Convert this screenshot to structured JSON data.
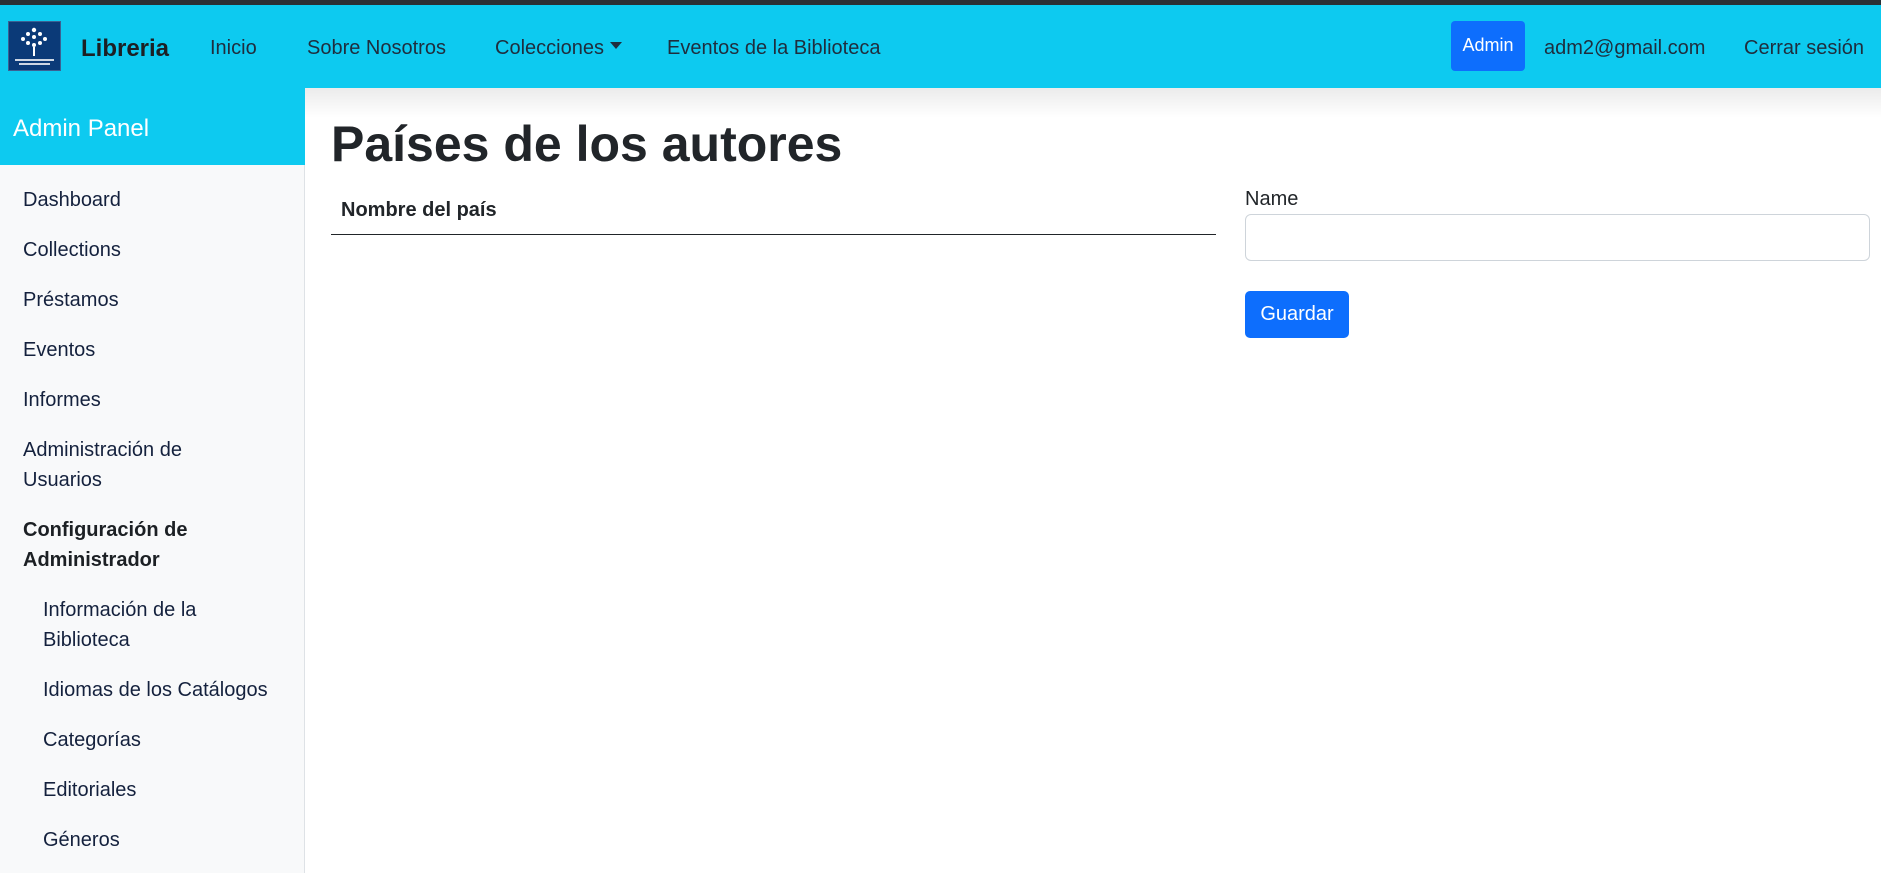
{
  "navbar": {
    "brand": "Libreria",
    "links": [
      "Inicio",
      "Sobre Nosotros",
      "Colecciones",
      "Eventos de la Biblioteca"
    ],
    "admin_badge": "Admin",
    "user_email": "adm2@gmail.com",
    "logout": "Cerrar sesión",
    "logo_icon": "university-logo-icon"
  },
  "sidebar": {
    "header": "Admin Panel",
    "items": [
      "Dashboard",
      "Collections",
      "Préstamos",
      "Eventos",
      "Informes",
      "Administración de Usuarios"
    ],
    "section": "Configuración de Administrador",
    "subitems": [
      "Información de la Biblioteca",
      "Idiomas de los Catálogos",
      "Categorías",
      "Editoriales",
      "Géneros"
    ]
  },
  "main": {
    "title": "Países de los autores",
    "table_header": "Nombre del país",
    "form": {
      "label": "Name",
      "value": "",
      "save_label": "Guardar"
    }
  },
  "colors": {
    "navbar_bg": "#0dcaf0",
    "primary": "#0d6efd",
    "sidebar_bg": "#f8f9fa"
  }
}
